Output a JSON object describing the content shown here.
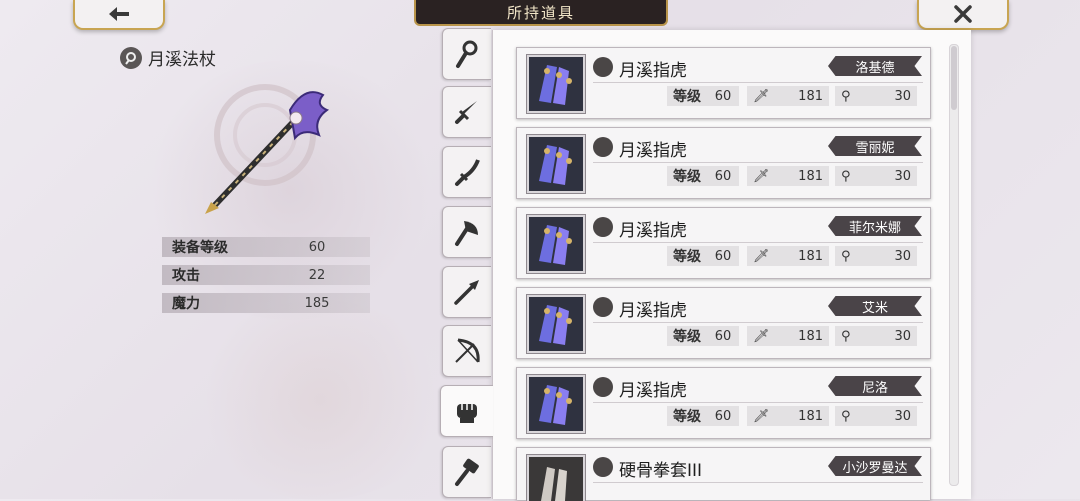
{
  "header": {
    "title": "所持道具",
    "back_icon": "arrow-left-icon",
    "close_icon": "close-x-icon"
  },
  "selected_item": {
    "name": "月溪法杖",
    "icon": "staff-category-icon",
    "stats": [
      {
        "label": "装备等级",
        "value": "60"
      },
      {
        "label": "攻击",
        "value": "22"
      },
      {
        "label": "魔力",
        "value": "185"
      }
    ]
  },
  "tabs": [
    {
      "icon": "staff-icon"
    },
    {
      "icon": "sword-icon"
    },
    {
      "icon": "katana-icon"
    },
    {
      "icon": "axe-icon"
    },
    {
      "icon": "spear-icon"
    },
    {
      "icon": "bow-icon"
    },
    {
      "icon": "fist-icon",
      "active": true
    },
    {
      "icon": "hammer-icon"
    }
  ],
  "items": [
    {
      "name": "月溪指虎",
      "owner": "洛基德",
      "level_label": "等级",
      "level": "60",
      "attack": "181",
      "magic": "30"
    },
    {
      "name": "月溪指虎",
      "owner": "雪丽妮",
      "level_label": "等级",
      "level": "60",
      "attack": "181",
      "magic": "30"
    },
    {
      "name": "月溪指虎",
      "owner": "菲尔米娜",
      "level_label": "等级",
      "level": "60",
      "attack": "181",
      "magic": "30"
    },
    {
      "name": "月溪指虎",
      "owner": "艾米",
      "level_label": "等级",
      "level": "60",
      "attack": "181",
      "magic": "30"
    },
    {
      "name": "月溪指虎",
      "owner": "尼洛",
      "level_label": "等级",
      "level": "60",
      "attack": "181",
      "magic": "30"
    },
    {
      "name": "硬骨拳套III",
      "owner": "小沙罗曼达"
    }
  ],
  "colors": {
    "accent_gold": "#c8a552",
    "title_bg": "#2a2222",
    "owner_tag": "#4a4448"
  }
}
